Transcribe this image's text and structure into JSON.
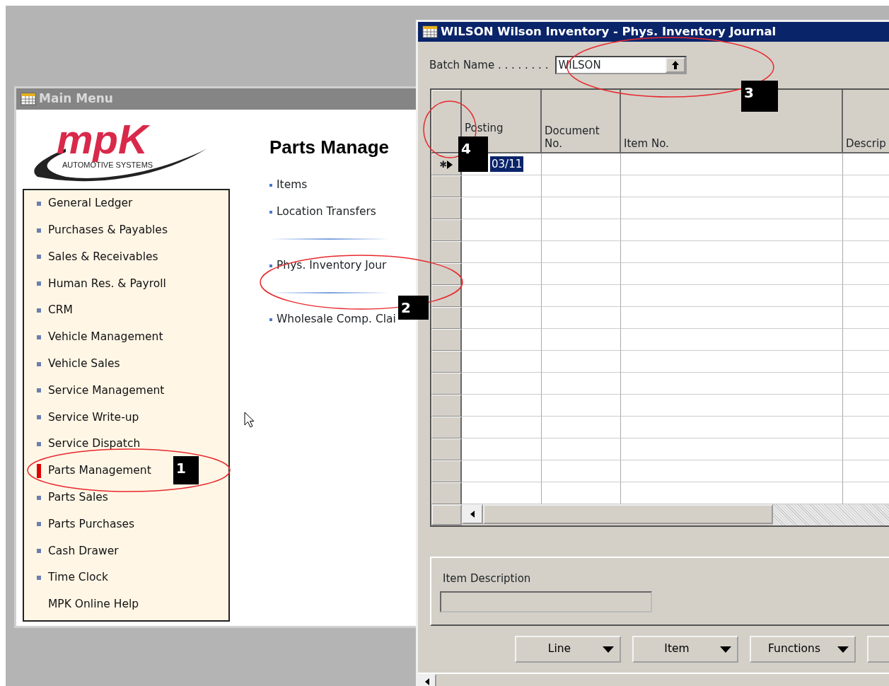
{
  "main_menu": {
    "title": "Main Menu",
    "logo": {
      "name": "mpK",
      "tagline": "AUTOMOTIVE SYSTEMS"
    },
    "items": [
      {
        "label": "General Ledger",
        "bullet": true,
        "selected": false
      },
      {
        "label": "Purchases & Payables",
        "bullet": true,
        "selected": false
      },
      {
        "label": "Sales & Receivables",
        "bullet": true,
        "selected": false
      },
      {
        "label": "Human Res. & Payroll",
        "bullet": true,
        "selected": false
      },
      {
        "label": "CRM",
        "bullet": true,
        "selected": false
      },
      {
        "label": "Vehicle Management",
        "bullet": true,
        "selected": false
      },
      {
        "label": "Vehicle Sales",
        "bullet": true,
        "selected": false
      },
      {
        "label": "Service Management",
        "bullet": true,
        "selected": false
      },
      {
        "label": "Service Write-up",
        "bullet": true,
        "selected": false
      },
      {
        "label": "Service Dispatch",
        "bullet": true,
        "selected": false
      },
      {
        "label": "Parts Management",
        "bullet": true,
        "selected": true
      },
      {
        "label": "Parts Sales",
        "bullet": true,
        "selected": false
      },
      {
        "label": "Parts Purchases",
        "bullet": true,
        "selected": false
      },
      {
        "label": "Cash Drawer",
        "bullet": true,
        "selected": false
      },
      {
        "label": "Time Clock",
        "bullet": true,
        "selected": false
      },
      {
        "label": "MPK Online Help",
        "bullet": false,
        "selected": false
      }
    ],
    "section": {
      "heading": "Parts Manage",
      "groups": [
        [
          "Items",
          "Location Transfers"
        ],
        [
          "Phys. Inventory Jour"
        ],
        [
          "Wholesale Comp. Clai"
        ]
      ]
    }
  },
  "journal": {
    "title": "WILSON Wilson Inventory - Phys. Inventory Journal",
    "batch_label": "Batch Name . . . . . . . .",
    "batch_value": "WILSON",
    "columns": [
      "Posting",
      "Document No.",
      "Item No.",
      "Descrip"
    ],
    "rows": [
      {
        "marker": "✱",
        "current": true,
        "posting_date": "03/11",
        "highlighted": true
      }
    ],
    "item_description": {
      "label": "Item Description"
    },
    "buttons": [
      {
        "label": "Line"
      },
      {
        "label": "Item"
      },
      {
        "label": "Functions"
      }
    ]
  },
  "annotations": [
    {
      "number": "1"
    },
    {
      "number": "2"
    },
    {
      "number": "3"
    },
    {
      "number": "4"
    }
  ]
}
